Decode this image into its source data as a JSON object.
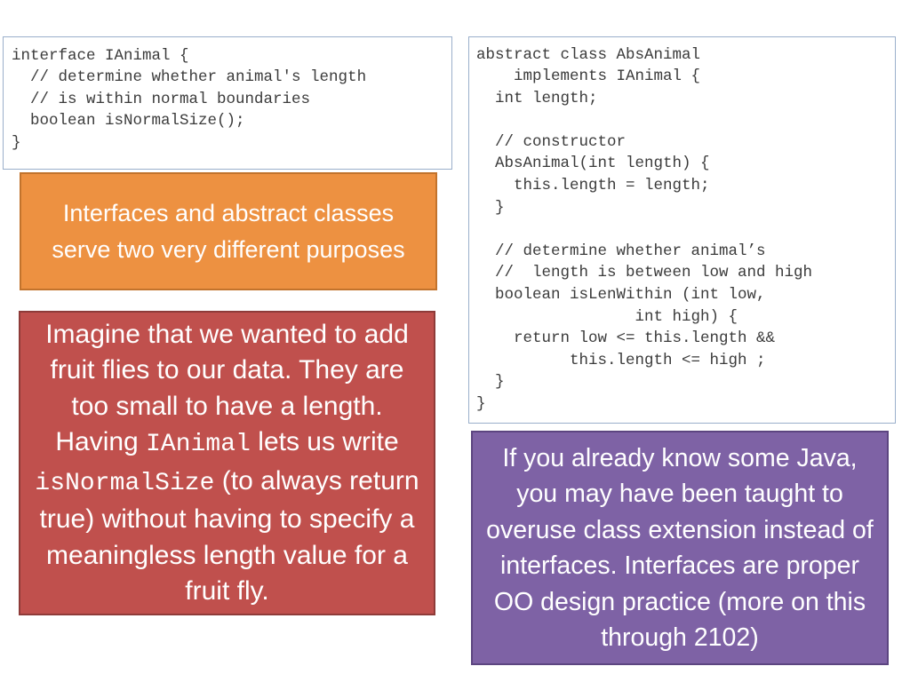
{
  "slide": {
    "code_blocks": [
      {
        "id": "interface-ianimal",
        "language": "java",
        "text": "interface IAnimal {\n  // determine whether animal's length\n  // is within normal boundaries\n  boolean isNormalSize();\n}"
      },
      {
        "id": "abstract-absanimal",
        "language": "java",
        "text": "abstract class AbsAnimal\n    implements IAnimal {\n  int length;\n\n  // constructor\n  AbsAnimal(int length) {\n    this.length = length;\n  }\n\n  // determine whether animal’s\n  //  length is between low and high\n  boolean isLenWithin (int low,\n                 int high) {\n    return low <= this.length &&\n          this.length <= high ;\n  }\n}"
      }
    ],
    "callouts": [
      {
        "id": "orange",
        "color": "#ED9141",
        "border_color": "#C2732C",
        "text": "Interfaces and abstract classes serve two very different purposes"
      },
      {
        "id": "red",
        "color": "#C0504D",
        "border_color": "#8E3B39",
        "segments": [
          {
            "kind": "text",
            "value": "Imagine that we wanted to add fruit flies to our data.  They are too small to have a length. Having "
          },
          {
            "kind": "code",
            "value": "IAnimal"
          },
          {
            "kind": "text",
            "value": " lets us write "
          },
          {
            "kind": "code",
            "value": "isNormalSize"
          },
          {
            "kind": "text",
            "value": " (to always return true) without having to specify a meaningless length value for a fruit fly."
          }
        ],
        "plain_text": "Imagine that we wanted to add fruit flies to our data.  They are too small to have a length. Having IAnimal lets us write isNormalSize (to always return true) without having to specify a meaningless length value for a fruit fly."
      },
      {
        "id": "purple",
        "color": "#7E62A5",
        "border_color": "#5C4580",
        "text": "If you already know some Java, you may have been taught to overuse class extension instead of interfaces.  Interfaces are proper OO design practice (more on this through 2102)"
      }
    ]
  }
}
